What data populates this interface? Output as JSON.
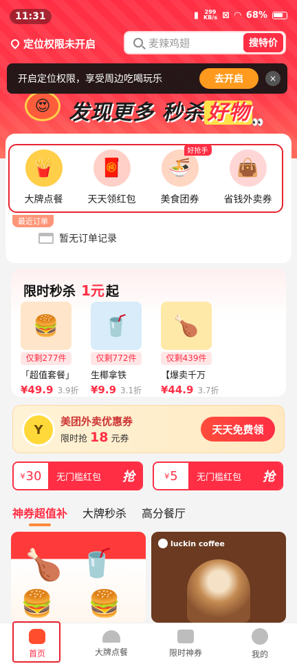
{
  "status_bar": {
    "time": "11:31",
    "speed": "299",
    "speed_unit": "KB/s",
    "battery": "68%"
  },
  "header": {
    "location_label": "定位权限未开启",
    "search_placeholder": "麦辣鸡翅",
    "search_button": "搜特价"
  },
  "banner": {
    "text_main": "发现更多 秒杀",
    "text_highlight": "好物"
  },
  "location_toast": {
    "message": "开启定位权限，享受周边吃喝玩乐",
    "open_button": "去开启",
    "close_icon": "×"
  },
  "categories": [
    {
      "label": "大牌点餐",
      "icon": "fries-icon",
      "color": "#ffcf4a",
      "glyph": "🍟"
    },
    {
      "label": "天天领红包",
      "icon": "red-envelope-icon",
      "color": "#ffd0c8",
      "glyph": "🧧"
    },
    {
      "label": "美食团券",
      "icon": "noodle-bowl-icon",
      "color": "#ffd6c2",
      "glyph": "🍜",
      "tag": "好抢手"
    },
    {
      "label": "省钱外卖券",
      "icon": "shopping-bag-icon",
      "color": "#ffd6d6",
      "glyph": "👜"
    }
  ],
  "recent_orders": {
    "tag": "最近订单",
    "empty_text": "暂无订单记录"
  },
  "flash_sale": {
    "title": "限时秒杀",
    "one_yuan": "1元",
    "qi": "起",
    "products": [
      {
        "sold": "仅剩277件",
        "name": "「超值套餐」",
        "price": "¥49.9",
        "discount": "3.9折",
        "glyph": "🍔",
        "color": "#ffe5c9"
      },
      {
        "sold": "仅剩772件",
        "name": "生椰拿铁",
        "price": "¥9.9",
        "discount": "3.1折",
        "glyph": "🥤",
        "color": "#d8ecfa"
      },
      {
        "sold": "仅剩439件",
        "name": "【爆卖千万",
        "price": "¥44.9",
        "discount": "3.7折",
        "glyph": "🍗",
        "color": "#ffe9a8"
      }
    ]
  },
  "coupon": {
    "logo_text": "Y",
    "title": "美团外卖优惠券",
    "sub_prefix": "限时抢",
    "amount": "18",
    "sub_suffix": "元券",
    "button": "天天免费领"
  },
  "red_packets": [
    {
      "currency": "¥",
      "amount": "30",
      "label": "无门槛红包",
      "action": "抢"
    },
    {
      "currency": "¥",
      "amount": "5",
      "label": "无门槛红包",
      "action": "抢"
    }
  ],
  "feed_tabs": [
    "神券超值补",
    "大牌秒杀",
    "高分餐厅"
  ],
  "feed": {
    "right_brand": "luckin coffee"
  },
  "bottom_nav": [
    {
      "label": "首页",
      "icon": "home-icon"
    },
    {
      "label": "大牌点餐",
      "icon": "cloche-icon"
    },
    {
      "label": "限时神券",
      "icon": "coupon-icon"
    },
    {
      "label": "我的",
      "icon": "profile-icon"
    }
  ],
  "colors": {
    "brand_red": "#ff2e44",
    "accent_orange": "#ff9a1e",
    "highlight_outline": "#e8232f"
  }
}
